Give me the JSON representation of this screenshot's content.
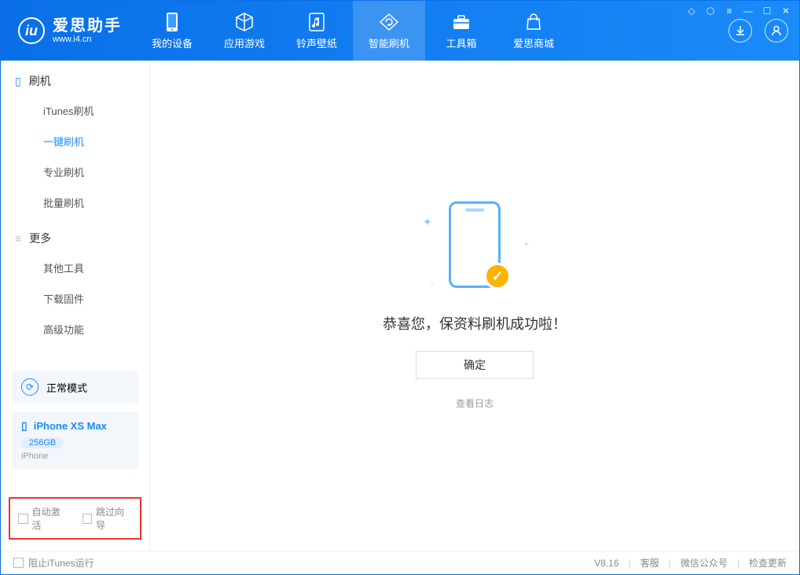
{
  "app": {
    "title": "爱思助手",
    "url": "www.i4.cn"
  },
  "titlebar": {
    "icons": [
      "tshirt",
      "skin",
      "menu",
      "minimize",
      "maximize",
      "close"
    ]
  },
  "tabs": [
    {
      "id": "device",
      "label": "我的设备"
    },
    {
      "id": "apps",
      "label": "应用游戏"
    },
    {
      "id": "ringtones",
      "label": "铃声壁纸"
    },
    {
      "id": "flash",
      "label": "智能刷机",
      "active": true
    },
    {
      "id": "toolbox",
      "label": "工具箱"
    },
    {
      "id": "store",
      "label": "爱思商城"
    }
  ],
  "sidebar": {
    "section1": {
      "title": "刷机"
    },
    "items1": [
      {
        "label": "iTunes刷机"
      },
      {
        "label": "一键刷机",
        "active": true
      },
      {
        "label": "专业刷机"
      },
      {
        "label": "批量刷机"
      }
    ],
    "section2": {
      "title": "更多"
    },
    "items2": [
      {
        "label": "其他工具"
      },
      {
        "label": "下载固件"
      },
      {
        "label": "高级功能"
      }
    ],
    "mode": {
      "label": "正常模式"
    },
    "device": {
      "name": "iPhone XS Max",
      "storage": "256GB",
      "type": "iPhone"
    },
    "redbox": {
      "opt1": "自动激活",
      "opt2": "跳过向导"
    }
  },
  "main": {
    "success_text": "恭喜您，保资料刷机成功啦！",
    "ok": "确定",
    "log": "查看日志"
  },
  "footer": {
    "block_itunes": "阻止iTunes运行",
    "version": "V8.16",
    "link1": "客服",
    "link2": "微信公众号",
    "link3": "检查更新"
  }
}
